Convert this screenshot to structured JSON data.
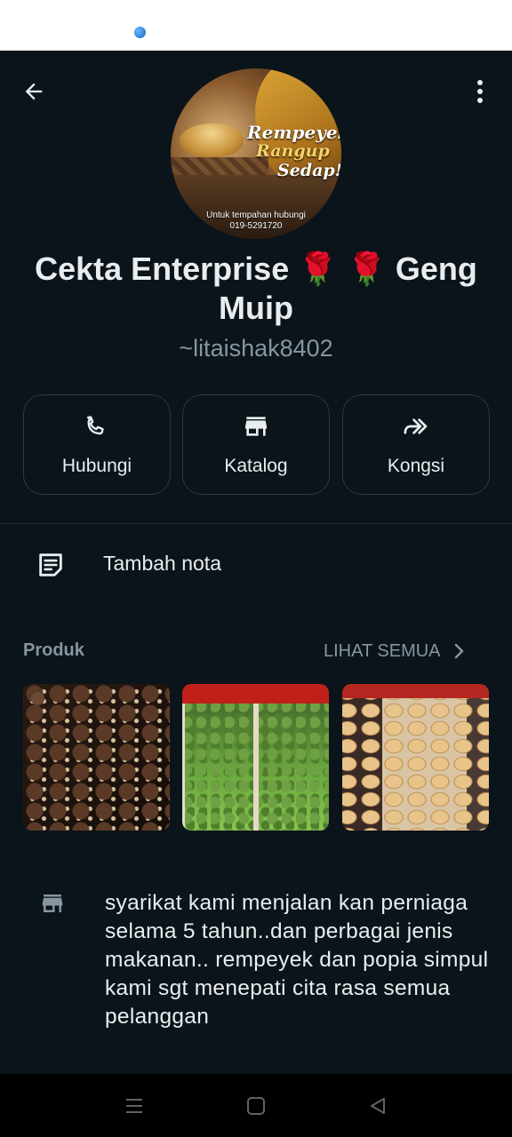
{
  "profile": {
    "avatar_text": {
      "line1": "Rempeyek",
      "line2": "Rangup",
      "line3": "Sedap!",
      "contact_line1": "Untuk tempahan hubungi",
      "contact_line2": "019-5291720"
    },
    "name": "Cekta Enterprise 🌹 🌹 Geng Muip",
    "handle": "~litaishak8402"
  },
  "actions": [
    {
      "label": "Hubungi",
      "icon": "phone-icon"
    },
    {
      "label": "Katalog",
      "icon": "store-icon"
    },
    {
      "label": "Kongsi",
      "icon": "share-icon"
    }
  ],
  "note": {
    "label": "Tambah nota",
    "icon": "note-icon"
  },
  "products": {
    "title": "Produk",
    "see_all_label": "LIHAT SEMUA"
  },
  "description": {
    "icon": "store-icon",
    "text": "syarikat kami menjalan kan perniaga selama 5 tahun..dan perbagai jenis makanan.. rempeyek dan popia simpul kami sgt menepati cita rasa semua pelanggan"
  },
  "colors": {
    "background": "#0b141a",
    "primary_text": "#e9edef",
    "secondary_text": "#8696a0",
    "border": "#2a3942"
  }
}
